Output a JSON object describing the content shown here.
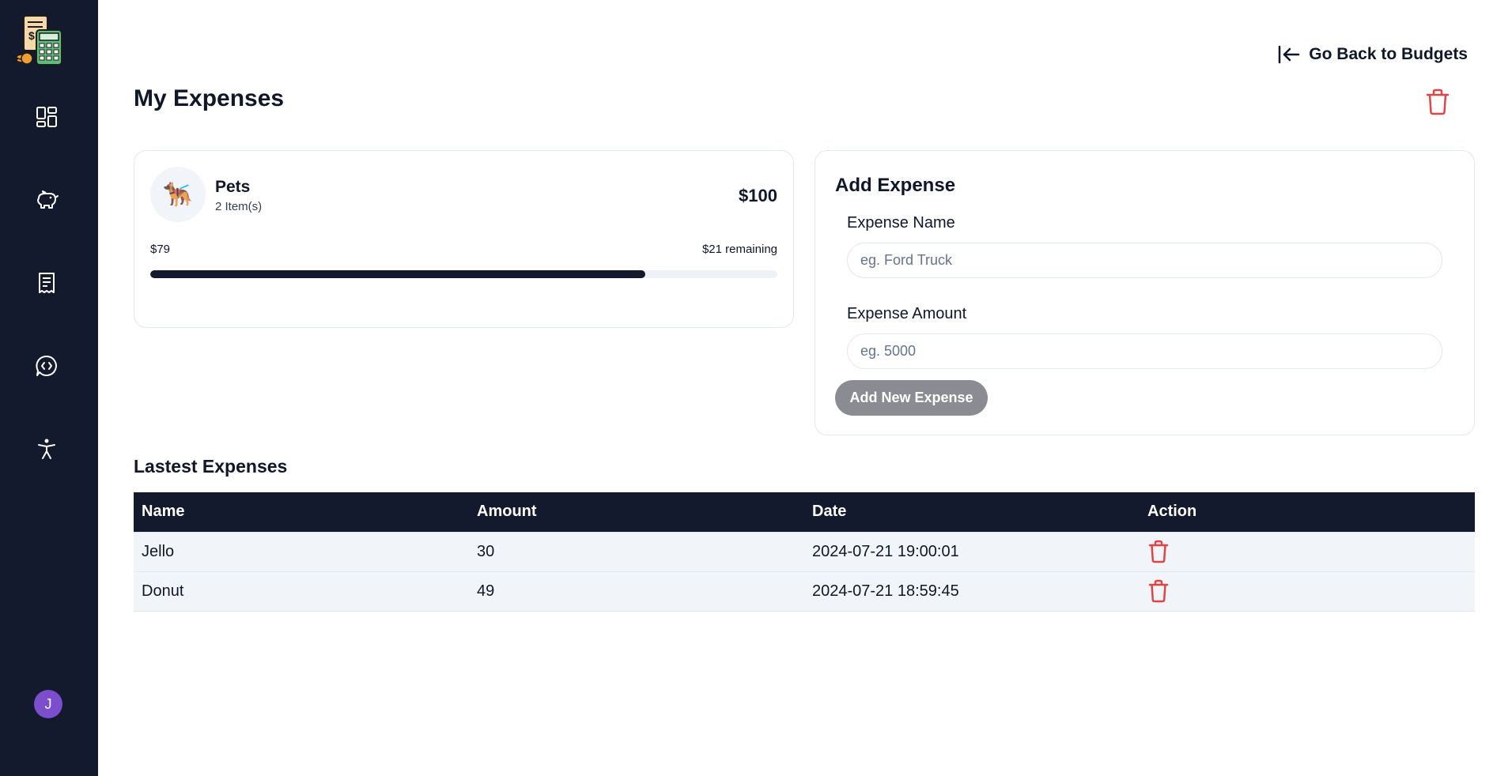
{
  "sidebar": {
    "logo_icon": "budget-calculator-logo",
    "items": [
      {
        "name": "dashboard",
        "icon": "dashboard-icon"
      },
      {
        "name": "budgets",
        "icon": "piggy-bank-icon"
      },
      {
        "name": "expenses",
        "icon": "receipt-icon"
      },
      {
        "name": "chat",
        "icon": "chat-code-icon"
      },
      {
        "name": "accessibility",
        "icon": "accessibility-icon"
      }
    ],
    "avatar_initial": "J",
    "bg_color": "#141a2d"
  },
  "header": {
    "back_label": "Go Back to Budgets",
    "title": "My Expenses"
  },
  "budget": {
    "emoji": "🐕‍🦺",
    "name": "Pets",
    "items": "2 Item(s)",
    "amount": "$100",
    "spent": "$79",
    "remaining": "$21 remaining",
    "progress_fraction": 0.79
  },
  "add_expense": {
    "title": "Add Expense",
    "name_label": "Expense Name",
    "name_placeholder": "eg. Ford Truck",
    "amount_label": "Expense Amount",
    "amount_placeholder": "eg. 5000",
    "button_label": "Add New Expense"
  },
  "latest": {
    "title": "Lastest Expenses",
    "columns": [
      "Name",
      "Amount",
      "Date",
      "Action"
    ],
    "rows": [
      {
        "name": "Jello",
        "amount": "30",
        "date": "2024-07-21 19:00:01"
      },
      {
        "name": "Donut",
        "amount": "49",
        "date": "2024-07-21 18:59:45"
      }
    ]
  },
  "colors": {
    "danger": "#e04545",
    "dark": "#141a2d",
    "button_disabled": "#8b8c93"
  }
}
